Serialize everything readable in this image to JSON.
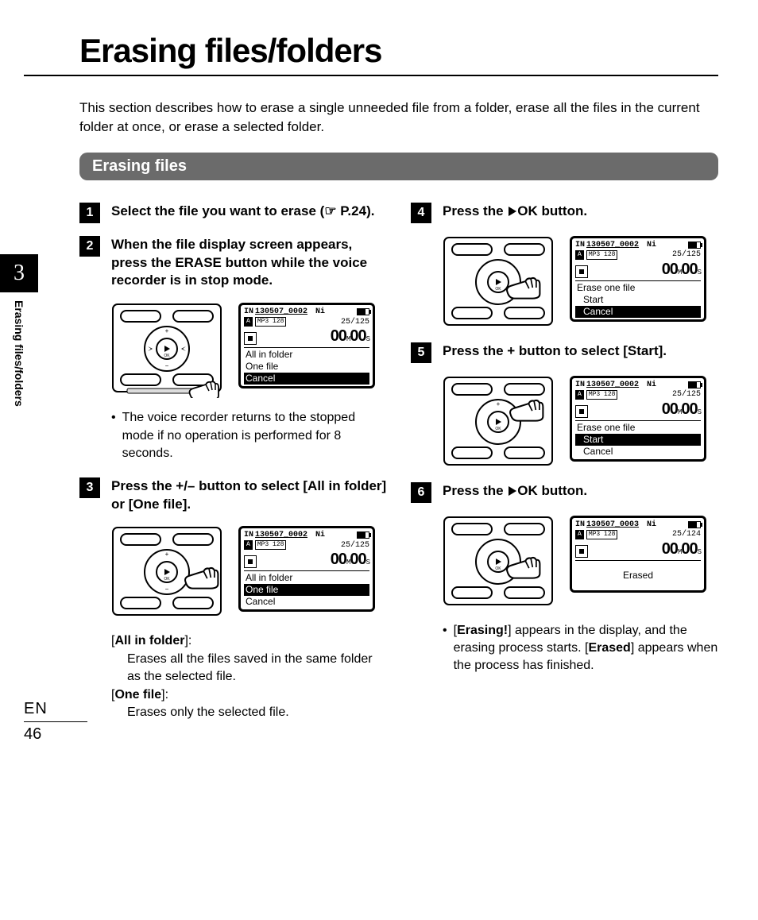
{
  "page_title": "Erasing files/folders",
  "intro": "This section describes how to erase a single unneeded file from a folder, erase all the files in the current folder at once, or erase a selected folder.",
  "section_bar": "Erasing files",
  "sidebar": {
    "chapter": "3",
    "label": "Erasing files/folders"
  },
  "footer": {
    "lang": "EN",
    "page": "46"
  },
  "left": {
    "step1": {
      "num": "1",
      "text_a": "Select the file you want to erase (",
      "pointer": "☞",
      "text_b": " P.24)."
    },
    "step2": {
      "num": "2",
      "text_a": "When the file display screen appears, press the ",
      "btn": "ERASE",
      "text_b": " button while the voice recorder is in stop mode."
    },
    "bullet1": "The voice recorder returns to the stopped mode if no operation is performed for 8 seconds.",
    "step3": {
      "num": "3",
      "text_a": "Press the ",
      "btn": "+/–",
      "text_b": " button to select [",
      "opt1": "All in folder",
      "text_c": "] or [",
      "opt2": "One file",
      "text_d": "]."
    },
    "defs": {
      "d1_label": "All in folder",
      "d1_text": "Erases all the files saved in the same folder as the selected file.",
      "d2_label": "One file",
      "d2_text": "Erases only the selected file."
    },
    "lcd2": {
      "filename": "130507_0002",
      "ni": "Ni",
      "folder": "A",
      "codec": "MP3 128",
      "counter": "25/125",
      "time_m": "00",
      "time_s": "00",
      "menu": [
        "All in folder",
        "One file",
        "Cancel"
      ],
      "selected": 2
    },
    "lcd3": {
      "filename": "130507_0002",
      "ni": "Ni",
      "folder": "A",
      "codec": "MP3 128",
      "counter": "25/125",
      "time_m": "00",
      "time_s": "00",
      "menu": [
        "All in folder",
        "One file",
        "Cancel"
      ],
      "selected": 1
    }
  },
  "right": {
    "step4": {
      "num": "4",
      "text_a": "Press the ",
      "ok": "OK",
      "text_b": " button."
    },
    "step5": {
      "num": "5",
      "text_a": "Press the ",
      "btn": "+",
      "text_b": " button to select [",
      "opt": "Start",
      "text_c": "]."
    },
    "step6": {
      "num": "6",
      "text_a": "Press the ",
      "ok": "OK",
      "text_b": " button."
    },
    "bullet": {
      "a": "[",
      "b": "Erasing!",
      "c": "] appears in the display, and the erasing process starts. [",
      "d": "Erased",
      "e": "] appears when the process has finished."
    },
    "lcd4": {
      "filename": "130507_0002",
      "ni": "Ni",
      "folder": "A",
      "codec": "MP3 128",
      "counter": "25/125",
      "time_m": "00",
      "time_s": "00",
      "heading": "Erase one file",
      "menu": [
        "Start",
        "Cancel"
      ],
      "selected": 1
    },
    "lcd5": {
      "filename": "130507_0002",
      "ni": "Ni",
      "folder": "A",
      "codec": "MP3 128",
      "counter": "25/125",
      "time_m": "00",
      "time_s": "00",
      "heading": "Erase one file",
      "menu": [
        "Start",
        "Cancel"
      ],
      "selected": 0
    },
    "lcd6": {
      "filename": "130507_0003",
      "ni": "Ni",
      "folder": "A",
      "codec": "MP3 128",
      "counter": "25/124",
      "time_m": "00",
      "time_s": "00",
      "message": "Erased"
    }
  }
}
